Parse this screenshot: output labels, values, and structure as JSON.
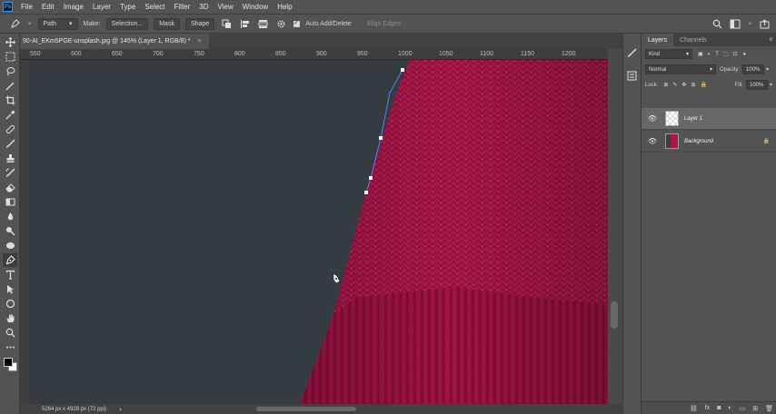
{
  "menubar": {
    "logo": "Ps",
    "items": [
      "File",
      "Edit",
      "Image",
      "Layer",
      "Type",
      "Select",
      "Filter",
      "3D",
      "View",
      "Window",
      "Help"
    ]
  },
  "options": {
    "mode": "Path",
    "make_label": "Make:",
    "selection_button": "Selection...",
    "mask_button": "Mask",
    "shape_button": "Shape",
    "auto_add_delete": "Auto Add/Delete",
    "align_edges": "Align Edges"
  },
  "document": {
    "tab_title": "90-AI_EKm5PGE-unsplash.jpg @ 145% (Layer 1, RGB/8) *",
    "status": "5264 px x 4928 px (72 ppi)"
  },
  "ruler": {
    "labels": [
      "550",
      "600",
      "650",
      "700",
      "750",
      "800",
      "850",
      "900",
      "950",
      "1000",
      "1050",
      "1100",
      "1150",
      "1200"
    ]
  },
  "layers_panel": {
    "tabs": [
      "Layers",
      "Channels"
    ],
    "kind": "Kind",
    "blend_mode": "Normal",
    "opacity_label": "Opacity:",
    "opacity_value": "100%",
    "lock_label": "Lock:",
    "fill_label": "Fill:",
    "fill_value": "100%",
    "layers": [
      {
        "name": "Layer 1"
      },
      {
        "name": "Background"
      }
    ]
  },
  "colors": {
    "canvas_bg": "#353c41",
    "sweater": "#a81749",
    "accent": "#2d9cf0"
  }
}
